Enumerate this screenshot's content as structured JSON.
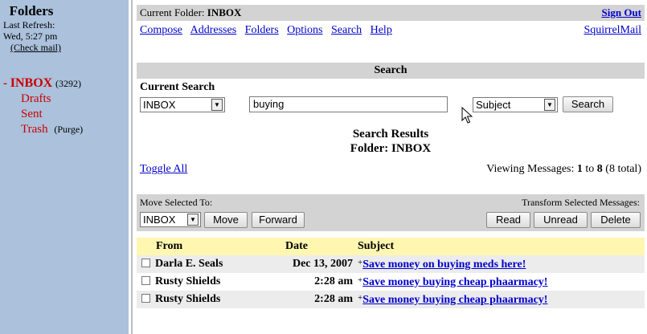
{
  "sidebar": {
    "title": "Folders",
    "refresh_label": "Last Refresh:",
    "refresh_time": "Wed, 5:27 pm",
    "check_mail": "(Check mail)",
    "inbox": {
      "prefix": "- ",
      "label": "INBOX",
      "count": "(3292)"
    },
    "folders": [
      "Drafts",
      "Sent",
      "Trash"
    ],
    "purge": "(Purge)"
  },
  "titlebar": {
    "current_folder_label": "Current Folder: ",
    "current_folder": "INBOX",
    "sign_out": "Sign Out"
  },
  "nav": {
    "links": [
      "Compose",
      "Addresses",
      "Folders",
      "Options",
      "Search",
      "Help"
    ],
    "brand": "SquirrelMail"
  },
  "search": {
    "header": "Search",
    "current_label": "Current Search",
    "folder_value": "INBOX",
    "query_value": "buying",
    "field_value": "Subject",
    "button": "Search"
  },
  "results": {
    "title": "Search Results",
    "folder_line": "Folder: INBOX",
    "toggle_all": "Toggle All",
    "viewing_prefix": "Viewing Messages: ",
    "range_start": "1",
    "range_to": " to ",
    "range_end": "8",
    "total": " (8 total)"
  },
  "actions": {
    "move_label": "Move Selected To:",
    "move_folder": "INBOX",
    "move_button": "Move",
    "forward_button": "Forward",
    "transform_label": "Transform Selected Messages:",
    "read_button": "Read",
    "unread_button": "Unread",
    "delete_button": "Delete"
  },
  "table": {
    "headers": {
      "from": "From",
      "date": "Date",
      "subject": "Subject"
    },
    "rows": [
      {
        "from": "Darla E. Seals",
        "date": "Dec 13, 2007",
        "subject": "Save money on buying meds here!"
      },
      {
        "from": "Rusty Shields",
        "date": "2:28 am",
        "subject": "Save money buying cheap phaarmacy!"
      },
      {
        "from": "Rusty Shields",
        "date": "2:28 am",
        "subject": "Save money buying cheap phaarmacy!"
      }
    ]
  },
  "colors": {
    "sidebar_bg": "#abc1dc",
    "folder_red": "#cc0000",
    "link_blue": "#0000cc",
    "header_gray": "#d3d3d3",
    "table_header_yellow": "#fff6b0"
  }
}
